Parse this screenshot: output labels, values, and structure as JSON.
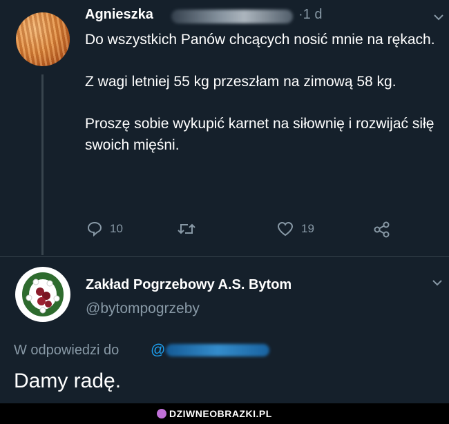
{
  "tweet": {
    "author_name": "Agnieszka",
    "time": "·1 d",
    "paragraphs": [
      "Do wszystkich Panów chcących nosić mnie na rękach.",
      "Z wagi letniej 55 kg przeszłam na zimową 58 kg.",
      "Proszę sobie wykupić karnet na siłownię i rozwijać siłę swoich mięśni."
    ],
    "reply_count": "10",
    "like_count": "19"
  },
  "reply": {
    "author_name": "Zakład Pogrzebowy A.S. Bytom",
    "handle": "@bytompogrzeby",
    "in_reply_to_label": "W odpowiedzi do",
    "in_reply_to_at": "@",
    "text": "Damy radę."
  },
  "watermark": {
    "text": "DZIWNEOBRAZKI.PL"
  },
  "colors": {
    "background": "#15202b",
    "muted": "#8899a6",
    "link": "#1da1f2",
    "divider": "#38444d"
  }
}
